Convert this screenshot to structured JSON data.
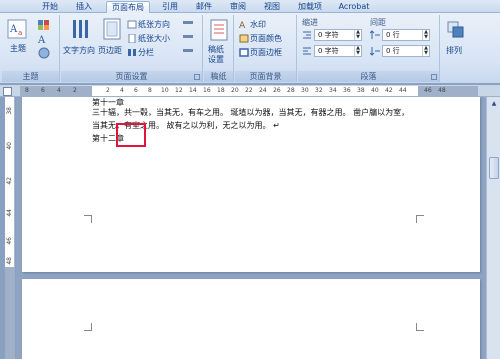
{
  "tabs": [
    {
      "label": "开始",
      "active": false
    },
    {
      "label": "插入",
      "active": false
    },
    {
      "label": "页面布局",
      "active": true
    },
    {
      "label": "引用",
      "active": false
    },
    {
      "label": "邮件",
      "active": false
    },
    {
      "label": "审阅",
      "active": false
    },
    {
      "label": "视图",
      "active": false
    },
    {
      "label": "加载项",
      "active": false
    },
    {
      "label": "Acrobat",
      "active": false
    }
  ],
  "ribbon": {
    "theme": {
      "title": "主题",
      "theme_button": "主题"
    },
    "page_setup": {
      "title": "页面设置",
      "text_direction": "文字方向",
      "margins": "页边距",
      "orientation": "纸张方向",
      "size": "纸张大小",
      "columns": "分栏"
    },
    "draft": {
      "title": "稿纸",
      "draft_setup": "稿纸\n设置"
    },
    "page_background": {
      "title": "页面背景",
      "watermark": "水印",
      "page_color": "页面颜色",
      "page_border": "页面边框"
    },
    "paragraph": {
      "title": "段落",
      "indent_label": "缩进",
      "spacing_label": "间距",
      "indent_left": "0 字符",
      "indent_right": "0 字符",
      "spacing_before": "0 行",
      "spacing_after": "0 行"
    },
    "arrange": {
      "label": "排列"
    }
  },
  "ruler": {
    "ticks": [
      "8",
      "6",
      "4",
      "2",
      "2",
      "4",
      "6",
      "8",
      "10",
      "12",
      "14",
      "16",
      "18",
      "20",
      "22",
      "24",
      "26",
      "28",
      "30",
      "32",
      "34",
      "36",
      "38",
      "40",
      "42",
      "44",
      "46",
      "48"
    ]
  },
  "vruler": {
    "ticks": [
      "38",
      "40",
      "42",
      "44",
      "46",
      "48"
    ]
  },
  "document": {
    "line0": "第十一章",
    "line1": "三十辐，共一毂，当其无，有车之用。 埏埴以为器，当其无，有器之用。 凿户牖以为室，",
    "line2": "当其无，有室之用。 故有之以为利，无之以为用。 ↵",
    "line3": "第十二章"
  },
  "colors": {
    "active_tab": "#fbfdff",
    "highlight": "#e0143c",
    "ribbon": "#d7e4f4"
  }
}
